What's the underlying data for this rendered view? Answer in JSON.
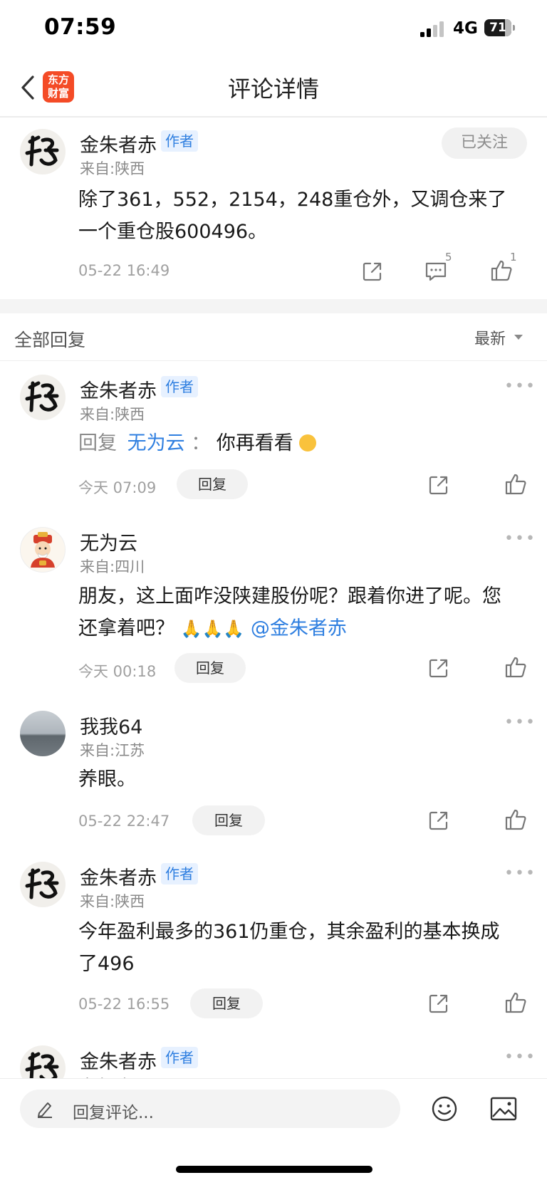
{
  "status_bar": {
    "time": "07:59",
    "network": "4G",
    "battery": "71"
  },
  "nav": {
    "title": "评论详情",
    "logo_text_line1": "东方",
    "logo_text_line2": "财富"
  },
  "main_post": {
    "author": "金朱者赤",
    "author_tag": "作者",
    "location": "来自:陕西",
    "follow_label": "已关注",
    "content_line1": "除了361，552，2154，248重仓外，又调仓来了",
    "content_line2": "一个重仓股600496。",
    "time": "05-22 16:49",
    "comment_count": "5",
    "like_count": "1"
  },
  "replies_header": {
    "title": "全部回复",
    "sort_label": "最新"
  },
  "replies": [
    {
      "author": "金朱者赤",
      "author_tag": "作者",
      "location": "来自:陕西",
      "reply_prefix": "回复",
      "reply_to": "无为云",
      "separator": "：",
      "content": "你再看看",
      "time": "今天 07:09",
      "reply_label": "回复"
    },
    {
      "author": "无为云",
      "location": "来自:四川",
      "content_line1": "朋友，这上面咋没陕建股份呢？跟着你进了呢。您",
      "content_line2": "还拿着吧？",
      "emojis": "🙏🙏🙏",
      "mention": "@金朱者赤",
      "time": "今天 00:18",
      "reply_label": "回复"
    },
    {
      "author": "我我64",
      "location": "来自:江苏",
      "content": "养眼。",
      "time": "05-22 22:47",
      "reply_label": "回复"
    },
    {
      "author": "金朱者赤",
      "author_tag": "作者",
      "location": "来自:陕西",
      "content_line1": "今年盈利最多的361仍重仓，其余盈利的基本换成",
      "content_line2": "了496",
      "time": "05-22 16:55",
      "reply_label": "回复"
    },
    {
      "author": "金朱者赤",
      "author_tag": "作者",
      "location": "来自:陕西"
    }
  ],
  "bottom_bar": {
    "placeholder": "回复评论..."
  },
  "more_glyph": "•••"
}
